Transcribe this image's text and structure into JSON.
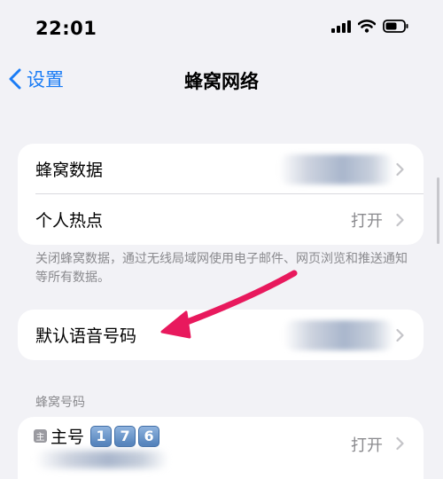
{
  "status_bar": {
    "time": "22:01"
  },
  "nav": {
    "back_label": "设置",
    "title": "蜂窝网络"
  },
  "card1": {
    "rows": [
      {
        "label": "蜂窝数据",
        "value": ""
      },
      {
        "label": "个人热点",
        "value": "打开"
      }
    ]
  },
  "footnote": "关闭蜂窝数据，通过无线局域网使用电子邮件、网页浏览和推送通知等所有数据。",
  "card2": {
    "label": "默认语音号码"
  },
  "section_cellular_numbers": {
    "header": "蜂窝号码",
    "sim_icon_text": "主",
    "line_label": "主号",
    "badge_digits": [
      "1",
      "7",
      "6"
    ],
    "value": "打开"
  },
  "colors": {
    "accent": "#1a7cf5",
    "arrow": "#e8195d"
  }
}
